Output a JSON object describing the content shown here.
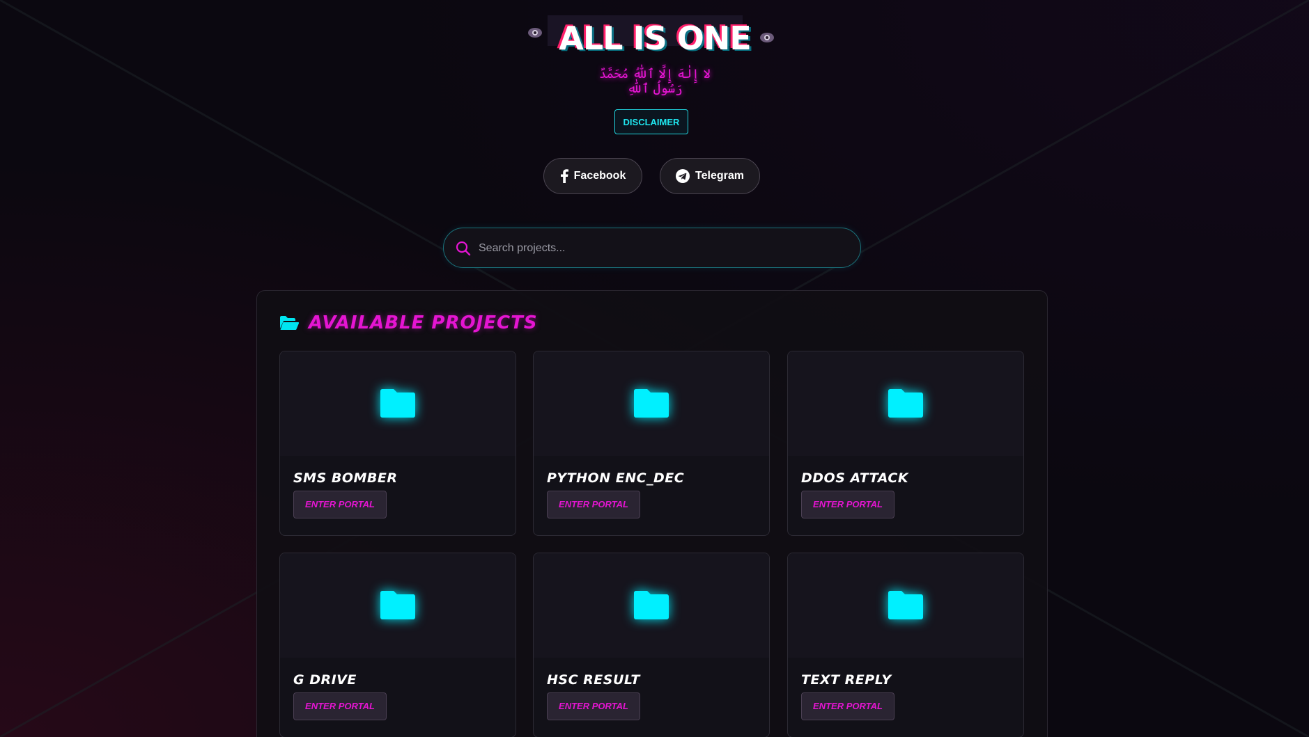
{
  "header": {
    "title": "ALL IS ONE",
    "subtitle": "لا إِلٰهَ إِلَّا ٱللّٰهُ مُحَمَّدٌ رَسُولُ ٱللّٰهِ",
    "disclaimer_label": "DISCLAIMER"
  },
  "social": {
    "facebook_label": "Facebook",
    "telegram_label": "Telegram"
  },
  "search": {
    "placeholder": "Search projects..."
  },
  "projects": {
    "heading": "AVAILABLE PROJECTS",
    "items": [
      {
        "name": "SMS BOMBER",
        "button": "ENTER PORTAL"
      },
      {
        "name": "PYTHON ENC_DEC",
        "button": "ENTER PORTAL"
      },
      {
        "name": "DDOS ATTACK",
        "button": "ENTER PORTAL"
      },
      {
        "name": "G DRIVE",
        "button": "ENTER PORTAL"
      },
      {
        "name": "HSC RESULT",
        "button": "ENTER PORTAL"
      },
      {
        "name": "TEXT REPLY",
        "button": "ENTER PORTAL"
      }
    ]
  },
  "colors": {
    "accent_magenta": "#e515d2",
    "accent_cyan": "#00f0ff",
    "background": "#0b0810"
  },
  "icons": {
    "heading": "folder-open-icon",
    "card": "folder-icon",
    "search": "search-icon",
    "facebook": "facebook-icon",
    "telegram": "telegram-icon",
    "eyes": "eye-icon"
  }
}
